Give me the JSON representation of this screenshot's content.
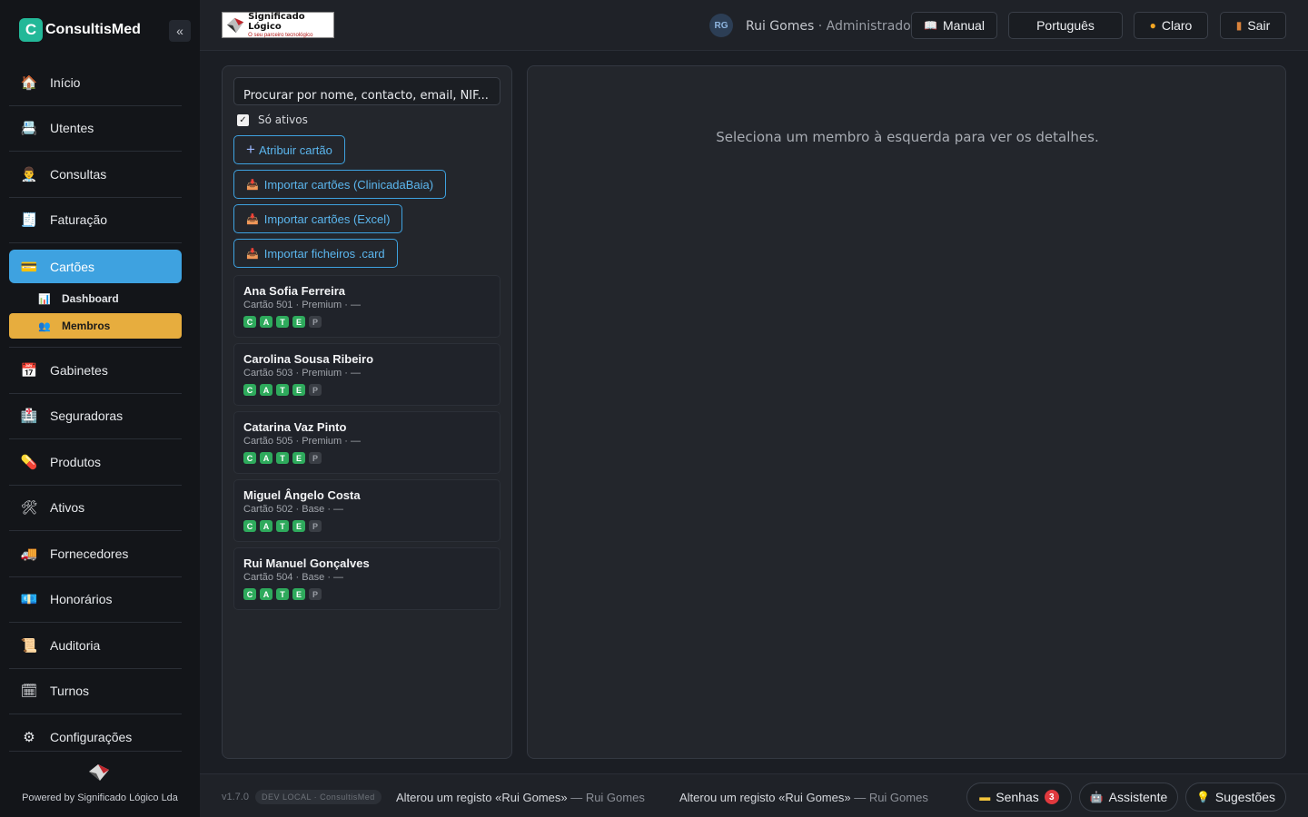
{
  "brand": {
    "logo_letter": "C",
    "name": "ConsultisMed",
    "collapse": "«"
  },
  "nav": {
    "items": [
      {
        "label": "Início",
        "icon": "🏠"
      },
      {
        "label": "Utentes",
        "icon": "📇"
      },
      {
        "label": "Consultas",
        "icon": "👨‍⚕️"
      },
      {
        "label": "Faturação",
        "icon": "🧾"
      }
    ],
    "active": {
      "label": "Cartões",
      "icon": "💳"
    },
    "sub_items": [
      {
        "label": "Dashboard",
        "icon": "📊"
      },
      {
        "label": "Membros",
        "icon": "👥"
      }
    ],
    "rest": [
      {
        "label": "Gabinetes",
        "icon": "📅"
      },
      {
        "label": "Seguradoras",
        "icon": "🏥"
      },
      {
        "label": "Produtos",
        "icon": "💊"
      },
      {
        "label": "Ativos",
        "icon": "🛠"
      },
      {
        "label": "Fornecedores",
        "icon": "🚚"
      },
      {
        "label": "Honorários",
        "icon": "💶"
      },
      {
        "label": "Auditoria",
        "icon": "📜"
      },
      {
        "label": "Turnos",
        "icon": "🗓"
      },
      {
        "label": "Configurações",
        "icon": "⚙"
      }
    ]
  },
  "sidebar_footer": {
    "powered": "Powered by Significado Lógico Lda"
  },
  "header": {
    "company_logo_title": "Significado Lógico",
    "company_logo_tagline": "O seu parceiro tecnológico",
    "avatar": "RG",
    "user_name": "Rui Gomes",
    "separator": " · ",
    "user_role": "Administrador",
    "manual": "Manual",
    "language": "Português",
    "theme": "Claro",
    "logout": "Sair"
  },
  "left": {
    "search_placeholder": "Procurar por nome, contacto, email, NIF...",
    "only_active": "Só ativos",
    "assign": "Atribuir cartão",
    "import_clinic": "Importar cartões (ClinicadaBaia)",
    "import_excel": "Importar cartões (Excel)",
    "import_card": "Importar ficheiros .card"
  },
  "members": [
    {
      "name": "Ana Sofia Ferreira",
      "meta": "Cartão 501 · Premium · —",
      "badges": [
        "C",
        "A",
        "T",
        "E",
        "P"
      ],
      "active": [
        true,
        true,
        true,
        true,
        false
      ]
    },
    {
      "name": "Carolina Sousa Ribeiro",
      "meta": "Cartão 503 · Premium · —",
      "badges": [
        "C",
        "A",
        "T",
        "E",
        "P"
      ],
      "active": [
        true,
        true,
        true,
        true,
        false
      ]
    },
    {
      "name": "Catarina Vaz Pinto",
      "meta": "Cartão 505 · Premium · —",
      "badges": [
        "C",
        "A",
        "T",
        "E",
        "P"
      ],
      "active": [
        true,
        true,
        true,
        true,
        false
      ]
    },
    {
      "name": "Miguel Ângelo Costa",
      "meta": "Cartão 502 · Base · —",
      "badges": [
        "C",
        "A",
        "T",
        "E",
        "P"
      ],
      "active": [
        true,
        true,
        true,
        true,
        false
      ]
    },
    {
      "name": "Rui Manuel Gonçalves",
      "meta": "Cartão 504 · Base · —",
      "badges": [
        "C",
        "A",
        "T",
        "E",
        "P"
      ],
      "active": [
        true,
        true,
        true,
        true,
        false
      ]
    }
  ],
  "right": {
    "empty": "Seleciona um membro à esquerda para ver os detalhes."
  },
  "footer": {
    "version": "v1.7.0",
    "env": "DEV LOCAL · ConsultisMed",
    "log1": "Alterou um registo «Rui Gomes»",
    "log1_who": " — Rui Gomes",
    "log2": "Alterou um registo «Rui Gomes»",
    "log2_who": " — Rui Gomes",
    "senhas": "Senhas",
    "senhas_count": "3",
    "assistant": "Assistente",
    "suggestions": "Sugestões"
  },
  "colors": {
    "accent": "#3ea2e0",
    "sub_active": "#e7ad3e",
    "badge_on": "#2eaa5c",
    "brand": "#23b898",
    "alert": "#e0393e"
  }
}
